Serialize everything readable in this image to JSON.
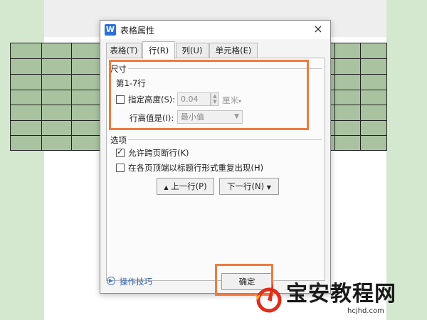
{
  "dialog": {
    "title": "表格属性",
    "app_icon": "W",
    "close_symbol": "×",
    "tabs": [
      {
        "label": "表格(T)",
        "active": false
      },
      {
        "label": "行(R)",
        "active": true
      },
      {
        "label": "列(U)",
        "active": false
      },
      {
        "label": "单元格(E)",
        "active": false
      }
    ],
    "size_group": {
      "label": "尺寸",
      "rows_label": "第1-7行",
      "specify_height_label": "指定高度(S):",
      "specify_height_checked": false,
      "height_value": "0.04",
      "unit_value": "厘米",
      "row_height_is_label": "行高值是(I):",
      "row_height_is_value": "最小值"
    },
    "options_group": {
      "label": "选项",
      "allow_break_label": "允许跨页断行(K)",
      "allow_break_checked": true,
      "repeat_header_label": "在各页顶端以标题行形式重复出现(H)",
      "repeat_header_checked": false
    },
    "prev_row_label": "上一行(P)",
    "next_row_label": "下一行(N)",
    "prev_row_icon": "▲",
    "next_row_icon": "▼",
    "help_label": "操作技巧",
    "ok_label": "确定"
  },
  "watermark": {
    "brand": "宝安教程网",
    "url": "hcjhd.com"
  },
  "colors": {
    "highlight": "#ee7b3f",
    "table_fill": "#a9c3a0",
    "page_bg": "#d4e8cf"
  }
}
